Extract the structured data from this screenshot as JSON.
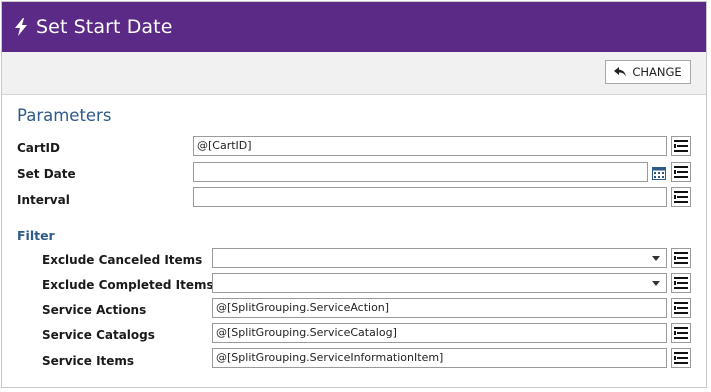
{
  "window": {
    "title": "Set Start Date",
    "icon": "lightning-bolt-icon",
    "accent_color": "#5b2a86"
  },
  "toolbar": {
    "change_label": "CHANGE",
    "change_icon": "undo-arrow-icon"
  },
  "parameters": {
    "heading": "Parameters",
    "fields": [
      {
        "label": "CartID",
        "value": "@[CartID]"
      },
      {
        "label": "Set Date",
        "value": ""
      },
      {
        "label": "Interval",
        "value": ""
      }
    ]
  },
  "filter": {
    "heading": "Filter",
    "fields": [
      {
        "label": "Exclude Canceled Items",
        "value": ""
      },
      {
        "label": "Exclude Completed Items",
        "value": ""
      },
      {
        "label": "Service Actions",
        "value": "@[SplitGrouping.ServiceAction]"
      },
      {
        "label": "Service Catalogs",
        "value": "@[SplitGrouping.ServiceCatalog]"
      },
      {
        "label": "Service Items",
        "value": "@[SplitGrouping.ServiceInformationItem]"
      }
    ]
  },
  "icons": {
    "field_menu": "list-menu-icon",
    "date_picker": "calendar-icon",
    "dropdown": "chevron-down-icon"
  }
}
